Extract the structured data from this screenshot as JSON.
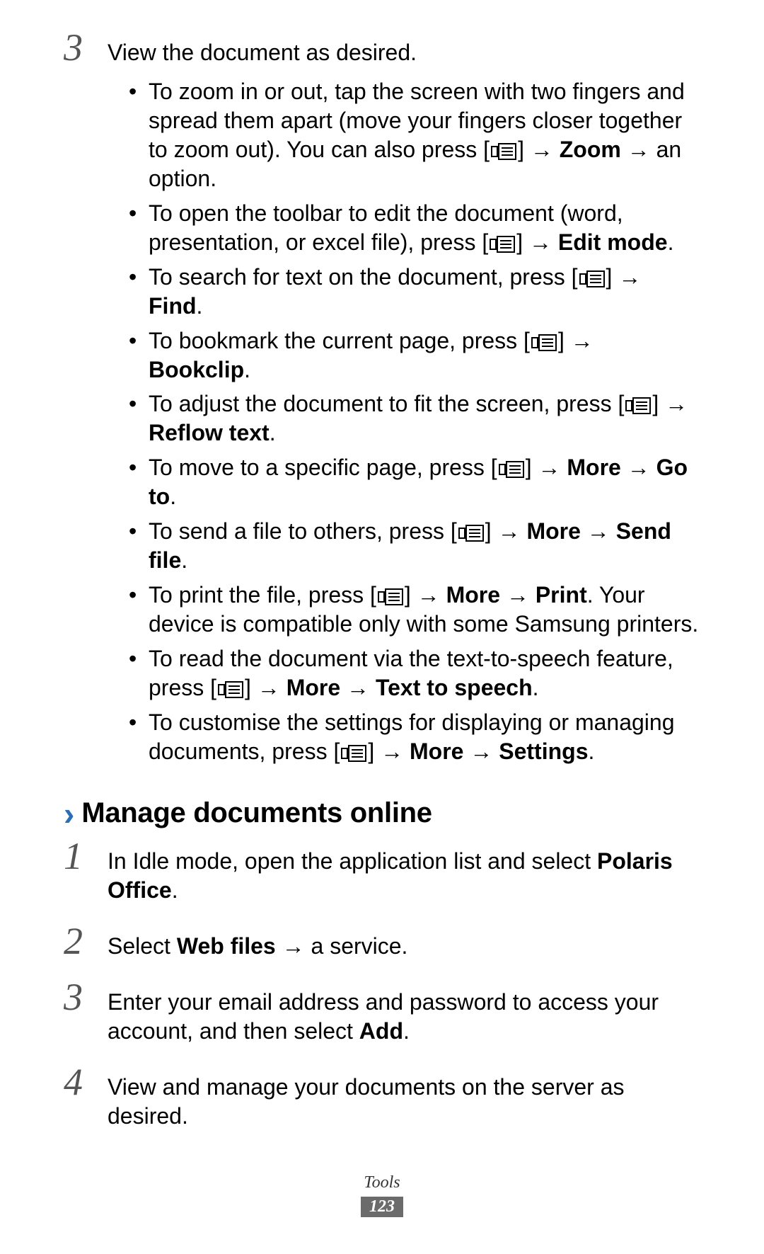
{
  "step3": {
    "number": "3",
    "intro": "View the document as desired.",
    "bullets": [
      {
        "pre": "To zoom in or out, tap the screen with two fingers and spread them apart (move your fingers closer together to zoom out). You can also press [",
        "post1": "] → ",
        "bold1": "Zoom",
        "post2": " → an option."
      },
      {
        "pre": "To open the toolbar to edit the document (word, presentation, or excel file), press [",
        "post1": "] → ",
        "bold1": "Edit mode",
        "post2": "."
      },
      {
        "pre": "To search for text on the document, press [",
        "post1": "] → ",
        "bold1": "Find",
        "post2": "."
      },
      {
        "pre": "To bookmark the current page, press [",
        "post1": "] → ",
        "bold1": "Bookclip",
        "post2": "."
      },
      {
        "pre": "To adjust the document to fit the screen, press [",
        "post1": "] → ",
        "bold1": "Reflow text",
        "post2": "."
      },
      {
        "pre": "To move to a specific page, press [",
        "post1": "] → ",
        "bold1": "More",
        "mid": " → ",
        "bold2": "Go to",
        "post2": "."
      },
      {
        "pre": "To send a file to others, press [",
        "post1": "] → ",
        "bold1": "More",
        "mid": " → ",
        "bold2": "Send file",
        "post2": "."
      },
      {
        "pre": "To print the file, press [",
        "post1": "] → ",
        "bold1": "More",
        "mid": " → ",
        "bold2": "Print",
        "post2": ". Your device is compatible only with some Samsung printers."
      },
      {
        "pre": "To read the document via the text-to-speech feature, press [",
        "post1": "] → ",
        "bold1": "More",
        "mid": " → ",
        "bold2": "Text to speech",
        "post2": "."
      },
      {
        "pre": "To customise the settings for displaying or managing documents, press [",
        "post1": "] → ",
        "bold1": "More",
        "mid": " → ",
        "bold2": "Settings",
        "post2": "."
      }
    ]
  },
  "sectionB": {
    "title": "Manage documents online",
    "steps": {
      "s1": {
        "number": "1",
        "pre": "In Idle mode, open the application list and select ",
        "bold": "Polaris Office",
        "post": "."
      },
      "s2": {
        "number": "2",
        "pre": "Select ",
        "bold": "Web files",
        "post": " → a service."
      },
      "s3": {
        "number": "3",
        "pre": "Enter your email address and password to access your account, and then select ",
        "bold": "Add",
        "post": "."
      },
      "s4": {
        "number": "4",
        "text": "View and manage your documents on the server as desired."
      }
    }
  },
  "footer": {
    "section": "Tools",
    "page": "123"
  }
}
